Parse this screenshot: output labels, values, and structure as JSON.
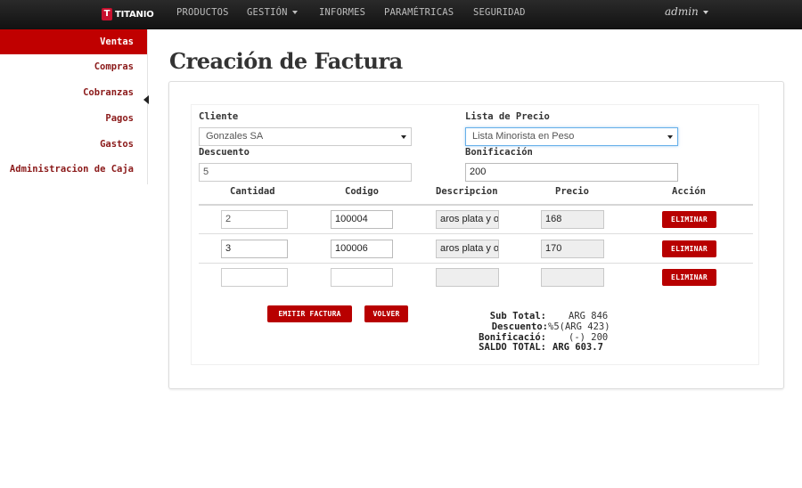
{
  "navbar": {
    "brand_logo": "T",
    "brand": "TITANIO",
    "items": [
      "PRODUCTOS",
      "GESTIÓN",
      "INFORMES",
      "PARAMÉTRICAS",
      "SEGURIDAD"
    ],
    "user": "admin"
  },
  "sidebar": {
    "items": [
      "Ventas",
      "Compras",
      "Cobranzas",
      "Pagos",
      "Gastos",
      "Administracion de Caja"
    ],
    "active": "Ventas"
  },
  "page": {
    "title": "Creación de Factura"
  },
  "form": {
    "cliente_label": "Cliente",
    "cliente_value": "Gonzales SA",
    "lista_label": "Lista de Precio",
    "lista_value": "Lista Minorista en Peso",
    "descuento_label": "Descuento",
    "descuento_value": "5",
    "bonificacion_label": "Bonificación",
    "bonificacion_value": "200"
  },
  "table": {
    "headers": [
      "Cantidad",
      "Codigo",
      "Descripcion",
      "Precio",
      "Acción"
    ],
    "rows": [
      {
        "cantidad": "2",
        "codigo": "100004",
        "descripcion": "aros plata y oro",
        "precio": "168"
      },
      {
        "cantidad": "3",
        "codigo": "100006",
        "descripcion": "aros plata y oro",
        "precio": "170"
      },
      {
        "cantidad": "",
        "codigo": "",
        "descripcion": "",
        "precio": ""
      }
    ],
    "delete_label": "ELIMINAR"
  },
  "actions": {
    "emit_label": "EMITIR FACTURA",
    "back_label": "VOLVER"
  },
  "summary": {
    "subtotal_label": "Sub Total:",
    "subtotal_value": "ARG 846",
    "descuento_label": "Descuento:",
    "descuento_value": "%5(ARG 423)",
    "bonificacion_label": "Bonificació:",
    "bonificacion_value": "(-) 200",
    "saldo_label": "SALDO TOTAL:",
    "saldo_value": "ARG 603.7"
  },
  "colors": {
    "accent": "#b80000",
    "navbar": "#1b1b1b",
    "sidebar_text": "#8b1a1a"
  },
  "icons": {
    "dropdown": "caret-down-icon",
    "collapse": "chevron-left-icon"
  }
}
